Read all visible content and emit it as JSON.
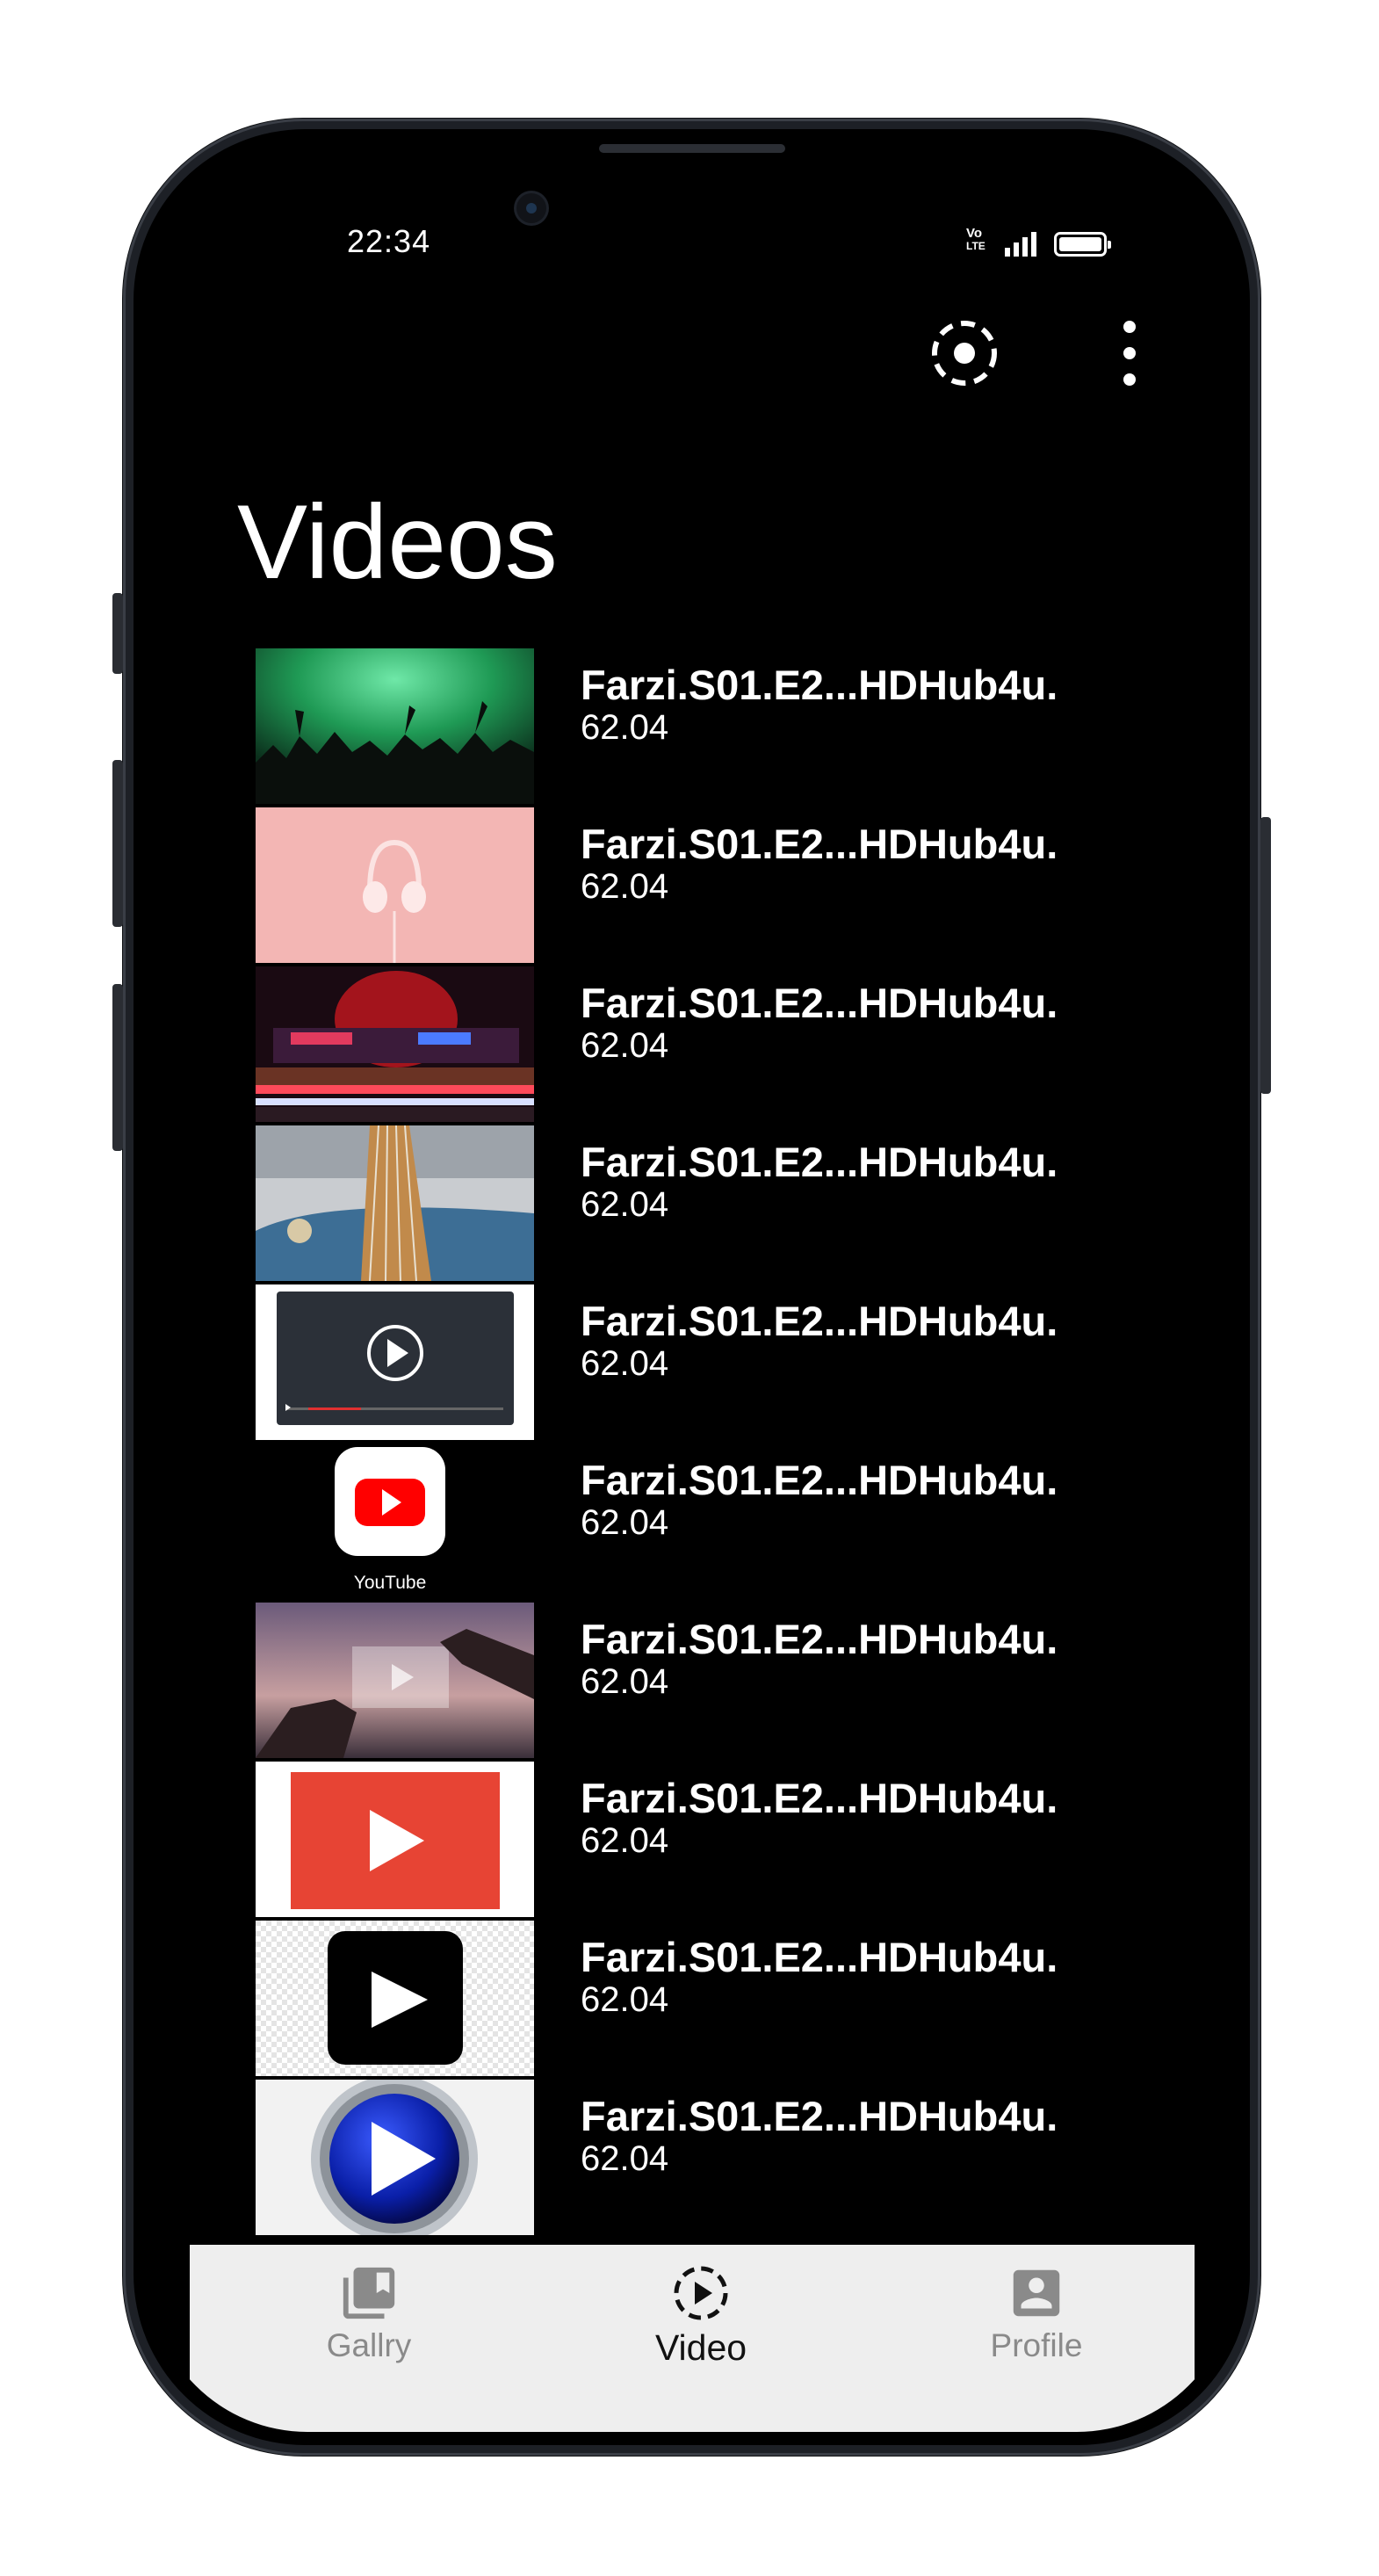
{
  "status_bar": {
    "time": "22:34",
    "network_badge_top": "Vo",
    "network_badge_bottom": "LTE"
  },
  "toolbar": {
    "scan_icon": "dashed-circle-icon",
    "menu_icon": "more-vert-icon"
  },
  "page": {
    "title": "Videos"
  },
  "videos": [
    {
      "name": "Farzi.S01.E2...HDHub4u.",
      "size": "62.04",
      "thumbnail": "concert-crowd-green"
    },
    {
      "name": "Farzi.S01.E2...HDHub4u.",
      "size": "62.04",
      "thumbnail": "pink-headphones"
    },
    {
      "name": "Farzi.S01.E2...HDHub4u.",
      "size": "62.04",
      "thumbnail": "cinema-neon"
    },
    {
      "name": "Farzi.S01.E2...HDHub4u.",
      "size": "62.04",
      "thumbnail": "guitar-closeup"
    },
    {
      "name": "Farzi.S01.E2...HDHub4u.",
      "size": "62.04",
      "thumbnail": "video-player"
    },
    {
      "name": "Farzi.S01.E2...HDHub4u.",
      "size": "62.04",
      "thumbnail": "youtube-app",
      "caption": "YouTube"
    },
    {
      "name": "Farzi.S01.E2...HDHub4u.",
      "size": "62.04",
      "thumbnail": "hands-frame"
    },
    {
      "name": "Farzi.S01.E2...HDHub4u.",
      "size": "62.04",
      "thumbnail": "red-play"
    },
    {
      "name": "Farzi.S01.E2...HDHub4u.",
      "size": "62.04",
      "thumbnail": "black-play"
    },
    {
      "name": "Farzi.S01.E2...HDHub4u.",
      "size": "62.04",
      "thumbnail": "blue-play-orb"
    }
  ],
  "bottom_nav": {
    "items": [
      {
        "label": "Gallry",
        "icon": "photo-library-icon",
        "active": false
      },
      {
        "label": "Video",
        "icon": "play-circle-dashed-icon",
        "active": true
      },
      {
        "label": "Profile",
        "icon": "account-box-icon",
        "active": false
      }
    ]
  },
  "colors": {
    "background": "#000000",
    "text": "#ffffff",
    "nav_background": "#eeeeee",
    "nav_inactive": "#8a8a8a",
    "nav_active": "#111111"
  }
}
